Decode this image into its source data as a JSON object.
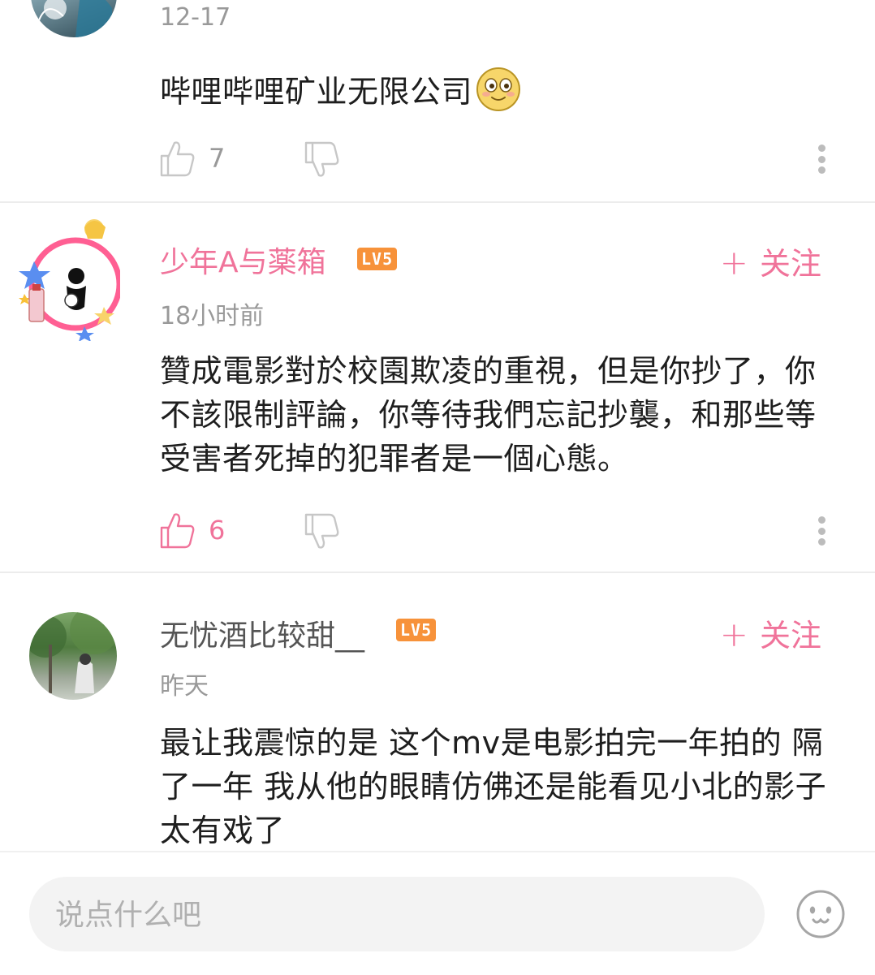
{
  "comments": [
    {
      "time": "12-17",
      "text": "哔哩哔哩矿业无限公司",
      "likes": "7"
    },
    {
      "username": "少年A与薬箱",
      "level": "LV5",
      "follow": "关注",
      "time": "18小时前",
      "text": "贊成電影對於校園欺凌的重視，但是你抄了，你不該限制評論，你等待我們忘記抄襲，和那些等受害者死掉的犯罪者是一個心態。",
      "likes": "6"
    },
    {
      "username": "无忧酒比较甜__",
      "level": "LV5",
      "follow": "关注",
      "time": "昨天",
      "text": "最让我震惊的是 这个mv是电影拍完一年拍的 隔了一年 我从他的眼睛仿佛还是能看见小北的影子 太有戏了"
    }
  ],
  "input": {
    "placeholder": "说点什么吧"
  },
  "colors": {
    "accent": "#f0739a",
    "level_badge": "#f7923a",
    "muted": "#999999"
  },
  "icons": [
    "thumbs-up-icon",
    "thumbs-down-icon",
    "more-vertical-icon",
    "emoji-icon"
  ]
}
